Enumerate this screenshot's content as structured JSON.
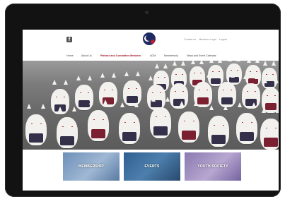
{
  "header": {
    "facebook_icon": "facebook-icon",
    "logo_icon": "society-logo-icon",
    "top_links": [
      "Contact us",
      "Members Login",
      "Logout"
    ]
  },
  "nav": {
    "items": [
      "Home",
      "About Us",
      "Patrons and Committee Members",
      "AGM",
      "Membership",
      "News and Event Calendar"
    ],
    "active": "Patrons and Committee Members"
  },
  "hero": {
    "image": "fox-statues-photo"
  },
  "cards": [
    {
      "label": "MEMBERSHIP"
    },
    {
      "label": "EVENTS"
    },
    {
      "label": "YOUTH SOCIETY"
    }
  ],
  "colors": {
    "accent": "#a01623",
    "device": "#121212",
    "logo_navy": "#1e2a63",
    "logo_red": "#c01d2d"
  }
}
